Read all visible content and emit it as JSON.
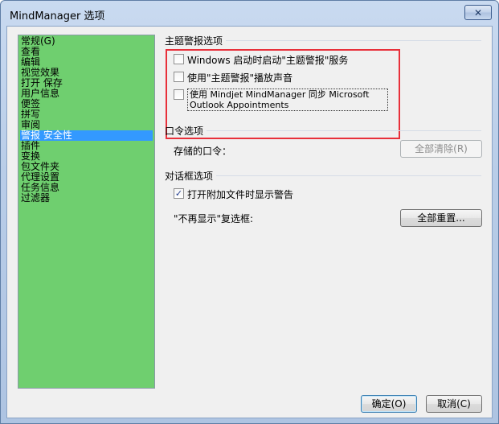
{
  "window": {
    "title": "MindManager 选项",
    "close_glyph": "✕"
  },
  "nav": {
    "items": [
      {
        "label": "常规(G)",
        "selected": false
      },
      {
        "label": "查看",
        "selected": false
      },
      {
        "label": "编辑",
        "selected": false
      },
      {
        "label": "视觉效果",
        "selected": false
      },
      {
        "label": "打开 保存",
        "selected": false
      },
      {
        "label": "用户信息",
        "selected": false
      },
      {
        "label": "便签",
        "selected": false
      },
      {
        "label": "拼写",
        "selected": false
      },
      {
        "label": "审阅",
        "selected": false
      },
      {
        "label": "警报 安全性",
        "selected": true
      },
      {
        "label": "插件",
        "selected": false
      },
      {
        "label": "变换",
        "selected": false
      },
      {
        "label": "包文件夹",
        "selected": false
      },
      {
        "label": "代理设置",
        "selected": false
      },
      {
        "label": "任务信息",
        "selected": false
      },
      {
        "label": "过滤器",
        "selected": false
      }
    ]
  },
  "alerts": {
    "title": "主题警报选项",
    "opt_windows_start": {
      "label": "Windows 启动时启动\"主题警报\"服务",
      "checked": false
    },
    "opt_sound": {
      "label": "使用\"主题警报\"播放声音",
      "checked": false
    },
    "opt_outlook_sync": {
      "label": "使用 Mindjet MindManager 同步 Microsoft Outlook Appointments",
      "checked": false
    }
  },
  "password": {
    "title": "口令选项",
    "stored_label": "存储的口令：",
    "clear_all_button": "全部清除(R)"
  },
  "dialog": {
    "title": "对话框选项",
    "opt_attach_warning": {
      "label": "打开附加文件时显示警告",
      "checked": true
    },
    "dont_show_label": "\"不再显示\"复选框:",
    "reset_all_button": "全部重置..."
  },
  "footer": {
    "ok_button": "确定(O)",
    "cancel_button": "取消(C)"
  },
  "colors": {
    "nav_background": "#6fcf6f",
    "selection": "#3399ff",
    "annotation_box": "#e8303a"
  }
}
